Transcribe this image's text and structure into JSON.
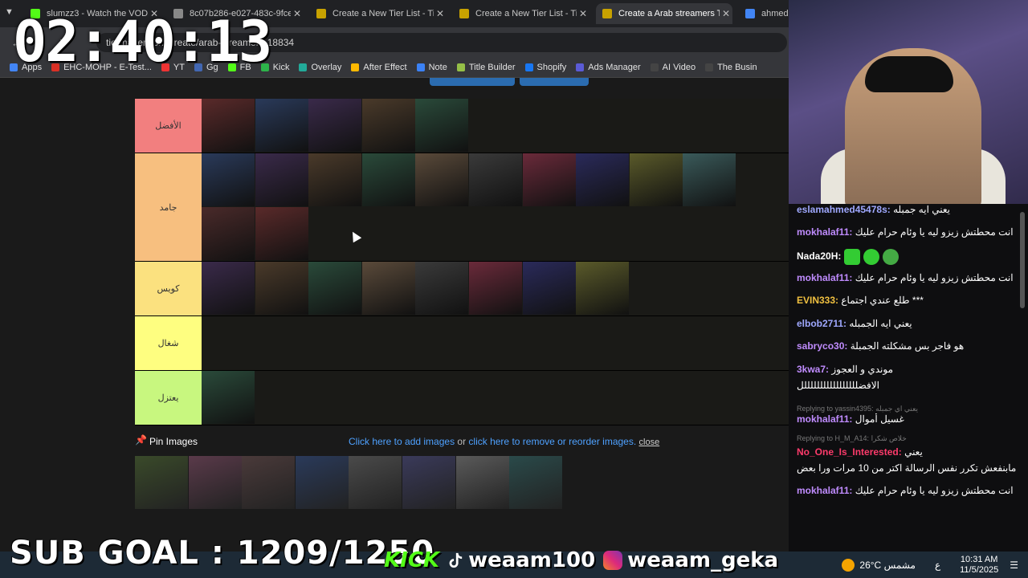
{
  "tabs": [
    {
      "title": "slumzz3 - Watch the VOD",
      "color": "#53fc18"
    },
    {
      "title": "8c07b286-e027-483c-9fce",
      "color": "#888888"
    },
    {
      "title": "Create a New Tier List - Tie",
      "color": "#c8a200"
    },
    {
      "title": "Create a New Tier List - Tie",
      "color": "#c8a200"
    },
    {
      "title": "Create a Arab streamers Ti",
      "color": "#c8a200",
      "active": true
    },
    {
      "title": "ahmeds",
      "color": "#4285f4"
    }
  ],
  "timer": "02:40:13",
  "url": "tiermaker.com/create/arab-streamers-18834",
  "bookmarks": [
    "Apps",
    "EHC-MOHP - E-Test...",
    "YT",
    "Gg",
    "FB",
    "Kick",
    "Overlay",
    "After Effect",
    "Note",
    "Title Builder",
    "Shopify",
    "Ads Manager",
    "AI Video",
    "The Busin"
  ],
  "tiers": [
    {
      "label": "الأفضل",
      "color": "#f27f7f",
      "count": 5
    },
    {
      "label": "جامد",
      "color": "#f7bf7f",
      "count": 12
    },
    {
      "label": "كويس",
      "color": "#fbe17f",
      "count": 8
    },
    {
      "label": "شغال",
      "color": "#fefe80",
      "count": 0
    },
    {
      "label": "يعتزل",
      "color": "#c8f77f",
      "count": 1
    }
  ],
  "pin": {
    "title": "Pin Images",
    "add": "Click here to add images",
    "or": " or ",
    "remove": "click here to remove or reorder images.",
    "close": "close",
    "count": 8
  },
  "chat": [
    {
      "user": "eslamahmed45478s",
      "color": "#9fa8ff",
      "text": "يعني ايه جمبله"
    },
    {
      "user": "mokhalaf11",
      "color": "#c08cff",
      "text": "انت محطتش زيزو ليه يا وئام حرام عليك"
    },
    {
      "user": "Nada20H",
      "color": "#ffffff",
      "text": ""
    },
    {
      "user": "mokhalaf11",
      "color": "#c08cff",
      "text": "انت محطتش زيزو ليه يا وئام حرام عليك"
    },
    {
      "user": "EVIN333",
      "color": "#f0c040",
      "text": "طلع عندي اجتماع ***"
    },
    {
      "user": "elbob2711",
      "color": "#9fa8ff",
      "text": "يعني ايه الجمبله"
    },
    {
      "user": "sabryco30",
      "color": "#c08cff",
      "text": "هو فاجر بس مشكلته الجمبلة"
    },
    {
      "user": "3kwa7",
      "color": "#c08cff",
      "text": "موندي و العجوز"
    },
    {
      "user": "",
      "color": "#ffffff",
      "text": "الافضلللللللللللللللللل"
    },
    {
      "user": "mokhalaf11",
      "color": "#c08cff",
      "text": "غسيل أموال"
    },
    {
      "user": "No_One_Is_Interested",
      "color": "#ff3b6b",
      "text": "يعني"
    },
    {
      "user": "",
      "color": "#ffffff",
      "text": "مابنفعش تكرر نفس الرسالة اكتر من 10 مرات ورا بعض"
    },
    {
      "user": "mokhalaf11",
      "color": "#c08cff",
      "text": "انت محطتش زيزو ليه يا وئام حرام عليك"
    }
  ],
  "replies": [
    "Replying to yassin4395: يعني اي جمبله",
    "Replying to H_M_A14: خلاص شكرا"
  ],
  "overlay": {
    "subgoal": "SUB GOAL : 1209/1250",
    "kick": "KICK",
    "tiktok": "weaam100",
    "instagram": "weaam_geka"
  },
  "tray": {
    "weather": "26°C مشمس",
    "time": "10:31 AM",
    "date": "11/5/2025",
    "lang": "ع"
  }
}
